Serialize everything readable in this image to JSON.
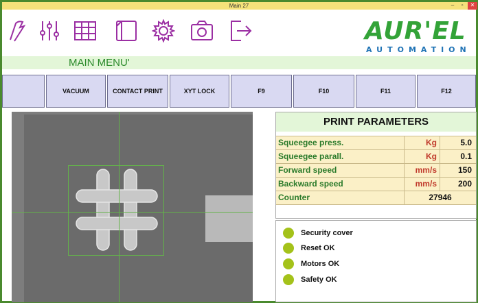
{
  "window": {
    "title": "Main 27",
    "minimize": "–",
    "maximize": "▫",
    "close": "✕"
  },
  "toolbar": {
    "tools": [
      {
        "icon": "stroke-icon"
      },
      {
        "icon": "sliders-icon"
      },
      {
        "icon": "grid-icon"
      },
      {
        "icon": "window-icon"
      },
      {
        "icon": "gear-icon"
      },
      {
        "icon": "camera-icon"
      },
      {
        "icon": "exit-icon"
      }
    ],
    "brand_colors": {
      "green": "#33a338",
      "blue": "#1f73b5"
    }
  },
  "logo": {
    "word": "AUR'EL",
    "sub": "AUTOMATION"
  },
  "menu": {
    "title": "MAIN MENU'"
  },
  "fkeys": [
    "",
    "VACUUM",
    "CONTACT PRINT",
    "XYT LOCK",
    "F9",
    "F10",
    "F11",
    "F12"
  ],
  "params": {
    "title": "PRINT PARAMETERS",
    "rows": [
      {
        "name": "Squeegee press.",
        "unit": "Kg",
        "value": "5.0"
      },
      {
        "name": "Squeegee parall.",
        "unit": "Kg",
        "value": "0.1"
      },
      {
        "name": "Forward speed",
        "unit": "mm/s",
        "value": "150"
      },
      {
        "name": "Backward speed",
        "unit": "mm/s",
        "value": "200"
      }
    ],
    "counter": {
      "name": "Counter",
      "value": "27946"
    }
  },
  "status": {
    "items": [
      {
        "label": "Security cover",
        "color": "#a4c21a"
      },
      {
        "label": "Reset OK",
        "color": "#a4c21a"
      },
      {
        "label": "Motors OK",
        "color": "#a4c21a"
      },
      {
        "label": "Safety OK",
        "color": "#a4c21a"
      }
    ]
  }
}
